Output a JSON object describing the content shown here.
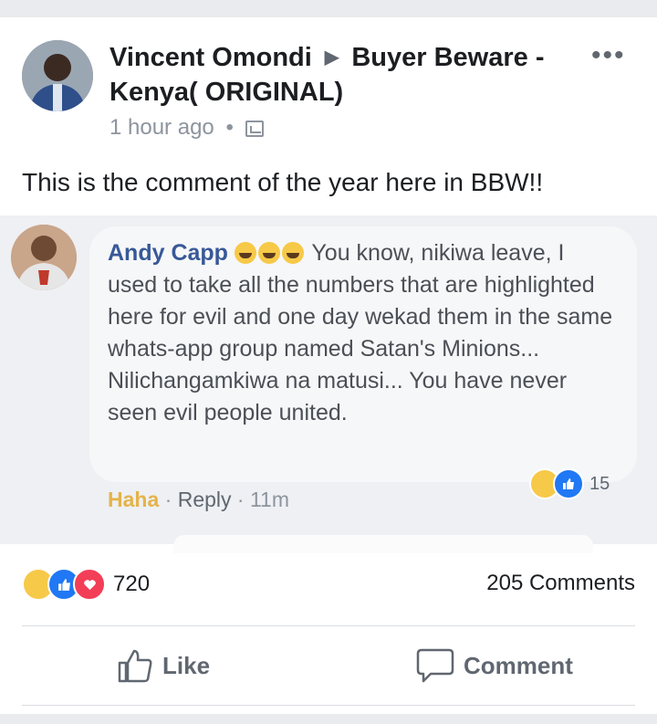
{
  "post": {
    "author": "Vincent Omondi",
    "arrow": "▶",
    "group": "Buyer Beware - Kenya( ORIGINAL)",
    "time": "1 hour ago",
    "separator": "•",
    "more": "•••",
    "text": "This is the comment of the year here in BBW!!"
  },
  "comment": {
    "author": "Andy Capp",
    "text": "You know, nikiwa leave, I used to take all the numbers that are highlighted here for evil and one day wekad them in the same whats-app group named Satan's Minions... Nilichangamkiwa na matusi... You have never seen evil people united.",
    "reaction_label": "Haha",
    "reply_label": "Reply",
    "time": "11m",
    "reaction_count": "15",
    "sep": "·"
  },
  "stats": {
    "reactions": "720",
    "comments": "205 Comments"
  },
  "actions": {
    "like": "Like",
    "comment": "Comment"
  },
  "colors": {
    "link_blue": "#385898",
    "like_blue": "#2078f4",
    "love_red": "#f33e58",
    "haha_yellow": "#f7c948",
    "haha_label": "#e5b34a",
    "bubble": "#f6f7f8"
  }
}
